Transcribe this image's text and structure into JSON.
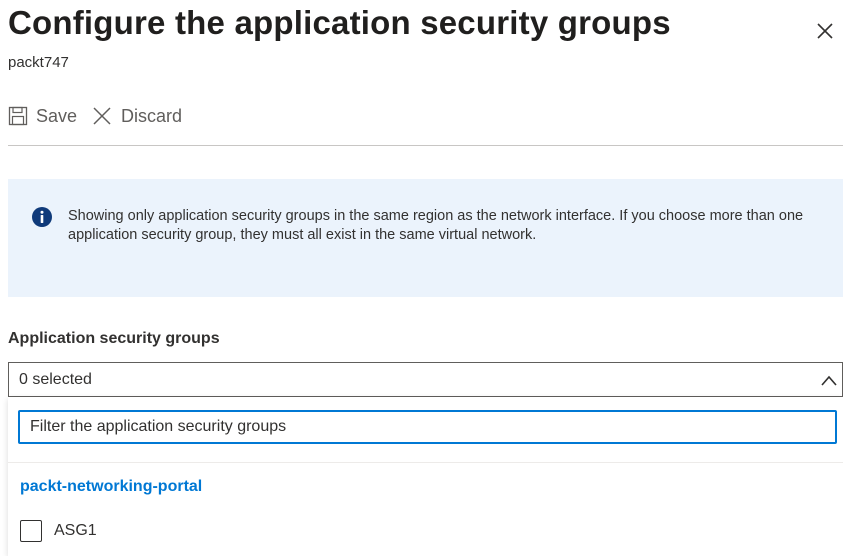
{
  "header": {
    "title": "Configure the application security groups",
    "subtitle": "packt747",
    "close_icon": "close-icon"
  },
  "toolbar": {
    "save_label": "Save",
    "save_icon": "save-icon",
    "discard_label": "Discard",
    "discard_icon": "close-icon"
  },
  "info": {
    "icon": "info-icon",
    "text": "Showing only application security groups in the same region as the network interface. If you choose more than one application security group, they must all exist in the same virtual network."
  },
  "field": {
    "label": "Application security groups",
    "selected_value": "0 selected",
    "filter_placeholder": "Filter the application security groups",
    "group_header": "packt-networking-portal",
    "options": [
      {
        "label": "ASG1",
        "checked": false
      }
    ]
  },
  "colors": {
    "accent": "#0078d4",
    "info_background": "#ebf3fc",
    "title_text": "#201f1e"
  }
}
